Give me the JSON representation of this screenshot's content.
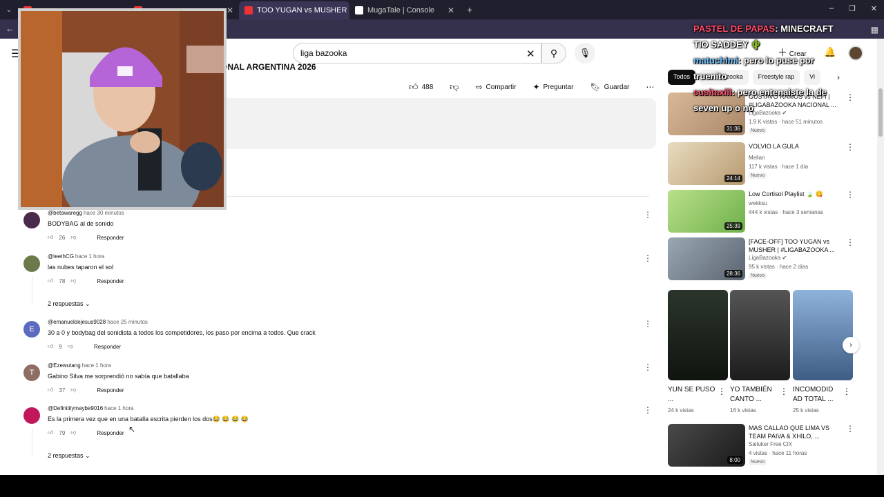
{
  "browser": {
    "tabs": [
      {
        "title": "",
        "active": false,
        "color": "#ff0000"
      },
      {
        "title": "",
        "active": false,
        "color": "#ff0000"
      },
      {
        "title": "TOO YUGAN vs MUSHER | #LIG",
        "active": true,
        "color": "#ff0000"
      },
      {
        "title": "MugaTale | Console",
        "active": false,
        "color": "#ffffff"
      }
    ],
    "new_tab": "+",
    "window_controls": [
      "–",
      "❐",
      "✕"
    ]
  },
  "youtube": {
    "search_value": "liga bazooka",
    "create_label": "Crear",
    "video_title": "ONAL ARGENTINA 2026",
    "likes": "488",
    "share_label": "Compartir",
    "ask_label": "Preguntar",
    "save_label": "Guardar"
  },
  "comments": [
    {
      "user": "@betawaregg",
      "time": "hace 30 minutos",
      "text": "BODYBAG al de sonido",
      "likes": "26",
      "reply": "Responder",
      "avatar_color": "#4a2a4a",
      "initial": ""
    },
    {
      "user": "@teethCG",
      "time": "hace 1 hora",
      "text": "las nubes taparon el sol",
      "likes": "78",
      "reply": "Responder",
      "avatar_color": "#6b7a4a",
      "initial": "",
      "replies": "2 respuestas"
    },
    {
      "user": "@emanueldejesus9028",
      "time": "hace 25 minutos",
      "text": "30 a 0 y bodybag del sonidista a todos los competidores, los paso por encima a todos. Que crack",
      "likes": "9",
      "reply": "Responder",
      "avatar_color": "#5c6bc0",
      "initial": "E"
    },
    {
      "user": "@Ezewutang",
      "time": "hace 1 hora",
      "text": "Gabino Silva me sorprendió no sabía que batallaba",
      "likes": "37",
      "reply": "Responder",
      "avatar_color": "#8d6e63",
      "initial": "T"
    },
    {
      "user": "@Definitilymaybe9016",
      "time": "hace 1 hora",
      "text": "Es la primera vez que en una batalla escrita pierden los dos😂 😂 😂 😂",
      "likes": "79",
      "reply": "Responder",
      "avatar_color": "#c2185b",
      "initial": "",
      "replies": "2 respuestas"
    }
  ],
  "sidebar": {
    "chips": [
      "Todos",
      "Liga Bazooka",
      "Freestyle rap",
      "Vi"
    ],
    "recommendations": [
      {
        "title": "GUSTAVO RAMOS vs NEFI | #LIGABAZOOKA NACIONAL ...",
        "channel": "LigaBazooka",
        "verified": true,
        "meta": "1.9 K vistas · hace 51 minutos",
        "badge": "Nuevo",
        "duration": "31:36",
        "thumb_color": "#c9a98a"
      },
      {
        "title": "VOLVIO LA GULA",
        "channel": "Melian",
        "verified": false,
        "meta": "117 k vistas · hace 1 día",
        "badge": "Nuevo",
        "duration": "24:14",
        "thumb_color": "#d8c7a0"
      },
      {
        "title": "Low Cortisol Playlist 🍃 😋",
        "channel": "wekksu",
        "verified": false,
        "meta": "444 k vistas · hace 3 semanas",
        "badge": "",
        "duration": "25:39",
        "thumb_color": "#9ccf6a"
      },
      {
        "title": "[FACE-OFF] TOO YUGAN vs MUSHER | #LIGABAZOOKA ...",
        "channel": "LigaBazooka",
        "verified": true,
        "meta": "95 k vistas · hace 2 días",
        "badge": "Nuevo",
        "duration": "28:36",
        "thumb_color": "#8a9aa8"
      },
      {
        "title": "MAS CALLAO QUE LIMA VS TEAM PAIVA & XHILO, ...",
        "channel": "Sailuker Free CIX",
        "verified": false,
        "meta": "4 vistas · hace 11 horas",
        "badge": "Nuevo",
        "duration": "8:00",
        "thumb_color": "#3a3a3a"
      }
    ],
    "shorts": [
      {
        "title": "YUN SE PUSO ...",
        "views": "24 k vistas",
        "thumb_color": "#1e2a1e"
      },
      {
        "title": "YO TAMBIÉN CANTO ...",
        "views": "16 k vistas",
        "thumb_color": "#3a3a3a"
      },
      {
        "title": "INCOMODID AD TOTAL ...",
        "views": "25 k vistas",
        "thumb_color": "#5d7fa8"
      }
    ]
  },
  "chat": [
    {
      "user": "PASTEL DE PAPAS",
      "message": "MINECRAFT",
      "user_color": "#ff4d6d"
    },
    {
      "user": "TIO SADDEY",
      "message": "🌵",
      "user_color": "#ffffff"
    },
    {
      "user": "matuchimi",
      "message": "pero lo puse por",
      "user_color": "#6ec1ff"
    },
    {
      "user": "truenito",
      "message": "",
      "user_color": "#ffffff"
    },
    {
      "user": "cusitaxili",
      "message": "pero entenaiste la de",
      "user_color": "#ff4d6d"
    },
    {
      "user": "",
      "message": "seven up o no",
      "user_color": "#ffffff"
    }
  ]
}
